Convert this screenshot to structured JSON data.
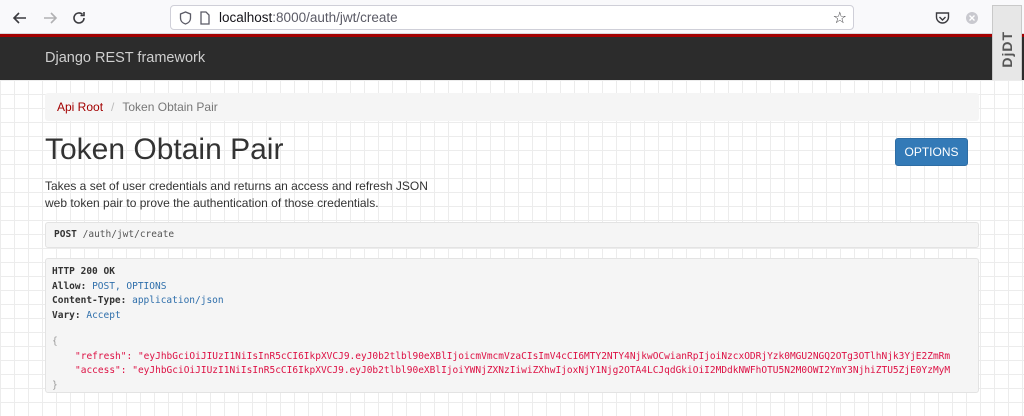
{
  "browser": {
    "url_host": "localhost",
    "url_path": ":8000/auth/jwt/create"
  },
  "navbar": {
    "brand": "Django REST framework",
    "djdt": "DjDT"
  },
  "breadcrumb": {
    "root": "Api Root",
    "current": "Token Obtain Pair"
  },
  "page": {
    "title": "Token Obtain Pair",
    "options_label": "OPTIONS",
    "description": "Takes a set of user credentials and returns an access and refresh JSON web token pair to prove the authentication of those credentials."
  },
  "request": {
    "method": "POST",
    "path": "/auth/jwt/create"
  },
  "response": {
    "status": "HTTP 200 OK",
    "headers": [
      {
        "name": "Allow:",
        "value": "POST, OPTIONS"
      },
      {
        "name": "Content-Type:",
        "value": "application/json"
      },
      {
        "name": "Vary:",
        "value": "Accept"
      }
    ],
    "open_brace": "{",
    "close_brace": "}",
    "refresh_key": "\"refresh\":",
    "refresh_value": "\"eyJhbGciOiJIUzI1NiIsInR5cCI6IkpXVCJ9.eyJ0b2tlbl90eXBlIjoicmVmcmVzaCIsImV4cCI6MTY2NTY4NjkwOCwianRpIjoiNzcxODRjYzk0MGU2NGQ2OTg3OTlhNjk3YjE2ZmRm",
    "access_key": "\"access\":",
    "access_value": "\"eyJhbGciOiJIUzI1NiIsInR5cCI6IkpXVCJ9.eyJ0b2tlbl90eXBlIjoiYWNjZXNzIiwiZXhwIjoxNjY1Njg2OTA4LCJqdGkiOiI2MDdkNWFhOTU5N2M0OWI2YmY3NjhiZTU5ZjE0YzMyM"
  },
  "colors": {
    "navbar": "#2c2c2c",
    "accent": "#a30000",
    "button": "#337ab7",
    "json_string": "#dd1144",
    "header_value": "#2f6fab"
  }
}
